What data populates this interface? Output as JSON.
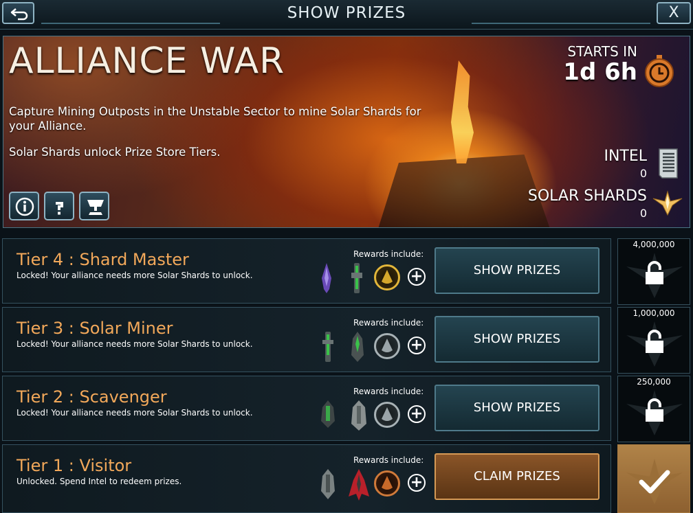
{
  "header": {
    "title": "SHOW PRIZES",
    "close_label": "X"
  },
  "event": {
    "title": "ALLIANCE WAR",
    "description": "Capture Mining Outposts in the Unstable Sector to mine Solar Shards for your Alliance.",
    "description2": "Solar Shards unlock Prize Store Tiers.",
    "starts_in_label": "STARTS IN",
    "starts_in_value": "1d 6h",
    "intel_label": "INTEL",
    "intel_value": "0",
    "shards_label": "SOLAR SHARDS",
    "shards_value": "0",
    "icons": [
      "info-icon",
      "help-icon",
      "trophy-icon",
      "stopwatch-icon",
      "intel-document-icon",
      "solar-shard-icon"
    ]
  },
  "tiers": [
    {
      "name": "Tier 4 : Shard Master",
      "status": "Locked! Your alliance needs more Solar Shards to unlock.",
      "rewards_label": "Rewards include:",
      "button": "SHOW PRIZES",
      "threshold": "4,000,000",
      "locked": true
    },
    {
      "name": "Tier 3 : Solar Miner",
      "status": "Locked! Your alliance needs more Solar Shards to unlock.",
      "rewards_label": "Rewards include:",
      "button": "SHOW PRIZES",
      "threshold": "1,000,000",
      "locked": true
    },
    {
      "name": "Tier 2 : Scavenger",
      "status": "Locked! Your alliance needs more Solar Shards to unlock.",
      "rewards_label": "Rewards include:",
      "button": "SHOW PRIZES",
      "threshold": "250,000",
      "locked": true
    },
    {
      "name": "Tier 1 : Visitor",
      "status": "Unlocked. Spend Intel to redeem prizes.",
      "rewards_label": "Rewards include:",
      "button": "CLAIM PRIZES",
      "locked": false
    }
  ],
  "colors": {
    "tier_name": "#f2a85a",
    "claim_button": "#8a5528",
    "show_button": "#244450",
    "gold_coin": "#d4a72c",
    "silver_coin": "#9aa4a8",
    "bronze_coin": "#c86a2a"
  }
}
